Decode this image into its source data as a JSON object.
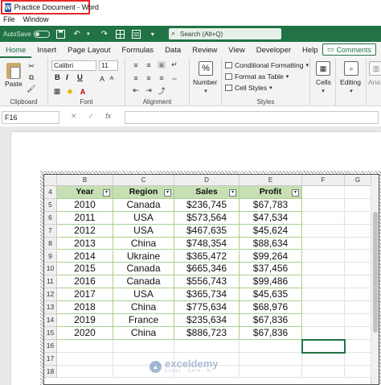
{
  "window": {
    "title": "Practice Document - Word",
    "app_icon": "word-icon"
  },
  "word_menu": [
    "File",
    "Window"
  ],
  "quick_access": {
    "autosave_label": "AutoSave",
    "autosave_state": "Off",
    "search_placeholder": "Search (Alt+Q)"
  },
  "tabs": [
    "Home",
    "Insert",
    "Page Layout",
    "Formulas",
    "Data",
    "Review",
    "View",
    "Developer",
    "Help"
  ],
  "active_tab": "Home",
  "comments_label": "Comments",
  "ribbon": {
    "clipboard": {
      "paste": "Paste",
      "label": "Clipboard"
    },
    "font": {
      "name": "Calibri",
      "size": "11",
      "bold": "B",
      "italic": "I",
      "underline": "U",
      "label": "Font"
    },
    "alignment": {
      "label": "Alignment"
    },
    "number": {
      "symbol": "%",
      "label": "Number"
    },
    "styles": {
      "conditional": "Conditional Formatting",
      "format_table": "Format as Table",
      "cell_styles": "Cell Styles",
      "label": "Styles"
    },
    "cells": {
      "label": "Cells"
    },
    "editing": {
      "label": "Editing"
    },
    "analysis": {
      "label": "Ana"
    }
  },
  "formula_bar": {
    "name_box": "F16",
    "cancel": "✕",
    "enter": "✓",
    "fx": "fx",
    "formula": ""
  },
  "sheet": {
    "columns": [
      "B",
      "C",
      "D",
      "E",
      "F",
      "G"
    ],
    "row_numbers": [
      "4",
      "5",
      "6",
      "7",
      "8",
      "9",
      "10",
      "11",
      "12",
      "13",
      "14",
      "15",
      "16",
      "17",
      "18"
    ],
    "headers": [
      "Year",
      "Region",
      "Sales",
      "Profit"
    ],
    "rows": [
      [
        "2010",
        "Canada",
        "$236,745",
        "$67,783"
      ],
      [
        "2011",
        "USA",
        "$573,564",
        "$47,534"
      ],
      [
        "2012",
        "USA",
        "$467,635",
        "$45,624"
      ],
      [
        "2013",
        "China",
        "$748,354",
        "$88,634"
      ],
      [
        "2014",
        "Ukraine",
        "$365,472",
        "$99,264"
      ],
      [
        "2015",
        "Canada",
        "$665,346",
        "$37,456"
      ],
      [
        "2016",
        "Canada",
        "$556,743",
        "$99,486"
      ],
      [
        "2017",
        "USA",
        "$365,734",
        "$45,635"
      ],
      [
        "2018",
        "China",
        "$775,634",
        "$68,976"
      ],
      [
        "2019",
        "France",
        "$235,634",
        "$67,836"
      ],
      [
        "2020",
        "China",
        "$886,723",
        "$67,836"
      ]
    ],
    "selected_cell": "F16"
  },
  "watermark": {
    "name": "exceldemy",
    "tagline": "EXCEL · DATA · BI"
  }
}
